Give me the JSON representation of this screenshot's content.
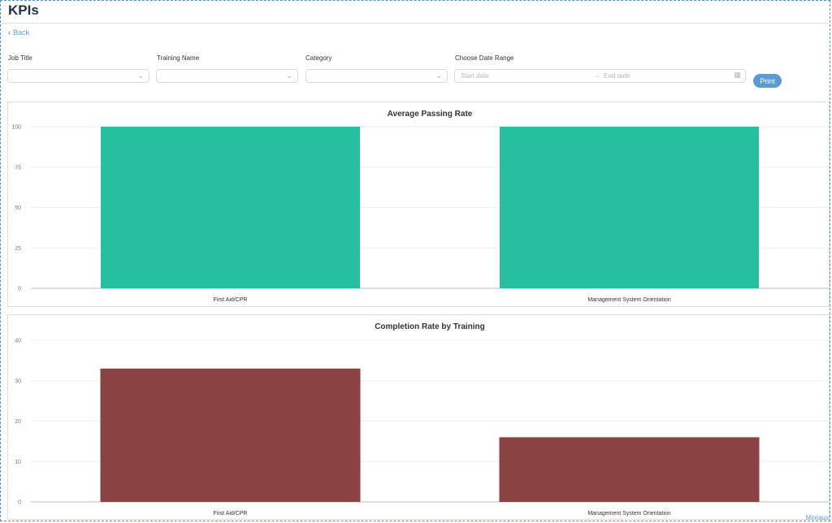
{
  "page": {
    "title": "KPIs",
    "back_label": "Back"
  },
  "filters": {
    "job_title_label": "Job Title",
    "training_name_label": "Training Name",
    "category_label": "Category",
    "date_range_label": "Choose Date Range",
    "start_placeholder": "Start date",
    "end_placeholder": "End date",
    "print_label": "Print"
  },
  "colors": {
    "accent": "#5b9bd5",
    "passing_bar": "#26bfa0",
    "completion_bar": "#8b4243"
  },
  "chart_data": [
    {
      "type": "bar",
      "title": "Average Passing Rate",
      "categories": [
        "First Aid/CPR",
        "Management System Orientation"
      ],
      "values": [
        100,
        100
      ],
      "ylim": [
        0,
        100
      ],
      "yticks": [
        0,
        25,
        50,
        75,
        100
      ],
      "color": "#26bfa0",
      "grid": true
    },
    {
      "type": "bar",
      "title": "Completion Rate by Training",
      "categories": [
        "First Aid/CPR",
        "Management System Orientation"
      ],
      "values": [
        33,
        16
      ],
      "ylim": [
        0,
        40
      ],
      "yticks": [
        0,
        10,
        20,
        30,
        40
      ],
      "color": "#8b4243",
      "grid": true
    }
  ],
  "footer": {
    "watermark": "Mireaux"
  }
}
